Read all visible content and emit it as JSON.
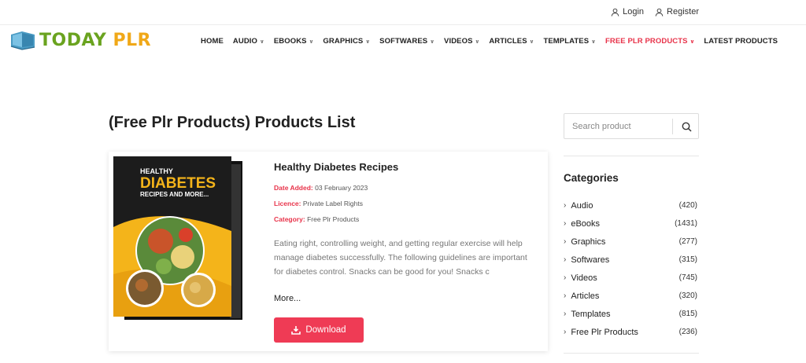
{
  "topbar": {
    "login": "Login",
    "register": "Register"
  },
  "logo": {
    "part1": "TODAY",
    "part2": "PLR"
  },
  "nav": [
    {
      "label": "HOME",
      "dropdown": false
    },
    {
      "label": "AUDIO",
      "dropdown": true
    },
    {
      "label": "EBOOKS",
      "dropdown": true
    },
    {
      "label": "GRAPHICS",
      "dropdown": true
    },
    {
      "label": "SOFTWARES",
      "dropdown": true
    },
    {
      "label": "VIDEOS",
      "dropdown": true
    },
    {
      "label": "ARTICLES",
      "dropdown": true
    },
    {
      "label": "TEMPLATES",
      "dropdown": true
    },
    {
      "label": "FREE PLR PRODUCTS",
      "dropdown": true,
      "active": true
    },
    {
      "label": "LATEST PRODUCTS",
      "dropdown": false
    }
  ],
  "page_title": "(Free Plr Products) Products List",
  "product": {
    "title": "Healthy Diabetes Recipes",
    "date_key": "Date Added:",
    "date_value": "03 February 2023",
    "licence_key": "Licence:",
    "licence_value": "Private Label Rights",
    "category_key": "Category:",
    "category_value": "Free Plr Products",
    "description": "Eating right, controlling weight, and getting regular exercise will help manage diabetes successfully. The following guidelines are important for diabetes control. Snacks can be good for you! Snacks c",
    "more": "More...",
    "download": "Download",
    "cover": {
      "line1": "HEALTHY",
      "line2": "DIABETES",
      "line3": "RECIPES AND MORE..."
    }
  },
  "search": {
    "placeholder": "Search product"
  },
  "categories": {
    "title": "Categories",
    "items": [
      {
        "label": "Audio",
        "count": "(420)"
      },
      {
        "label": "eBooks",
        "count": "(1431)"
      },
      {
        "label": "Graphics",
        "count": "(277)"
      },
      {
        "label": "Softwares",
        "count": "(315)"
      },
      {
        "label": "Videos",
        "count": "(745)"
      },
      {
        "label": "Articles",
        "count": "(320)"
      },
      {
        "label": "Templates",
        "count": "(815)"
      },
      {
        "label": "Free Plr Products",
        "count": "(236)"
      }
    ]
  },
  "colors": {
    "accent": "#ef3b55",
    "logo_green": "#6aa31f",
    "logo_orange": "#f0a818"
  }
}
